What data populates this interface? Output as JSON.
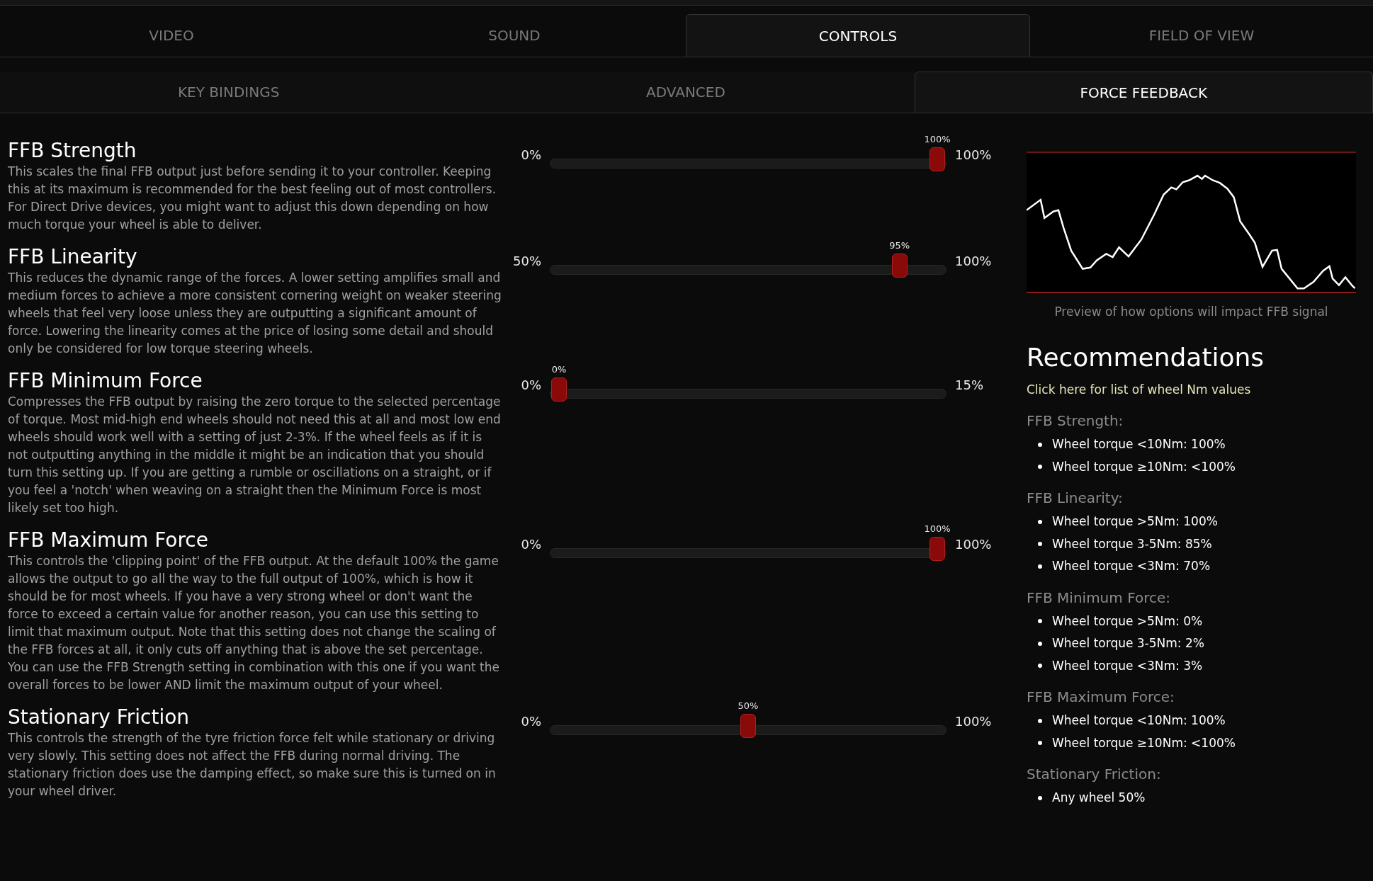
{
  "main_tabs": [
    {
      "label": "VIDEO",
      "selected": false
    },
    {
      "label": "SOUND",
      "selected": false
    },
    {
      "label": "CONTROLS",
      "selected": true
    },
    {
      "label": "FIELD OF VIEW",
      "selected": false
    }
  ],
  "sub_tabs": [
    {
      "label": "KEY BINDINGS",
      "selected": false
    },
    {
      "label": "ADVANCED",
      "selected": false
    },
    {
      "label": "FORCE FEEDBACK",
      "selected": true
    }
  ],
  "settings": [
    {
      "title": "FFB Strength",
      "description": "This scales the final FFB output just before sending it to your controller. Keeping this at its maximum is recommended for the best feeling out of most controllers. For Direct Drive devices, you might want to adjust this down depending on how much torque your wheel is able to deliver.",
      "min": "0%",
      "max": "100%",
      "value": "100%",
      "level": 1
    },
    {
      "title": "FFB Linearity",
      "description": "This reduces the dynamic range of the forces. A lower setting amplifies small and medium forces to achieve a more consistent cornering weight on weaker steering wheels that feel very loose unless they are outputting a significant amount of force. Lowering the linearity comes at the price of losing some detail and should only be considered for low torque steering wheels.",
      "min": "50%",
      "max": "100%",
      "value": "95%",
      "level": 0.9
    },
    {
      "title": "FFB Minimum Force",
      "description": "Compresses the FFB output by raising the zero torque to the selected percentage of torque. Most mid-high end wheels should not need this at all and most low end wheels should work well with a setting of just 2-3%. If the wheel feels as if it is not outputting anything in the middle it might be an indication that you should turn this setting up. If you are getting a rumble or oscillations on a straight, or if you feel a 'notch' when weaving on a straight then the Minimum Force is most likely set too high.",
      "min": "0%",
      "max": "15%",
      "value": "0%",
      "level": 0
    },
    {
      "title": "FFB Maximum Force",
      "description": "This controls the 'clipping point' of the FFB output. At the default 100% the game allows the output to go all the way to the full output of 100%, which is how it should be for most wheels. If you have a very strong wheel or don't want the force to exceed a certain value for another reason, you can use this setting to limit that maximum output. Note that this setting does not change the scaling of the FFB forces at all, it only cuts off anything that is above the set percentage. You can use the FFB Strength setting in combination with this one if you want the overall forces to be lower AND limit the maximum output of your wheel.",
      "min": "0%",
      "max": "100%",
      "value": "100%",
      "level": 1
    },
    {
      "title": "Stationary Friction",
      "description": "This controls the strength of the tyre friction force felt while stationary or driving very slowly. This setting does not affect the FFB during normal driving. The stationary friction does use the damping effect, so make sure this is turned on in your wheel driver.",
      "min": "0%",
      "max": "100%",
      "value": "50%",
      "level": 0.5
    }
  ],
  "preview": {
    "caption": "Preview of how options will impact FFB signal"
  },
  "recommendations": {
    "title": "Recommendations",
    "link": "Click here for list of wheel Nm values",
    "groups": [
      {
        "heading": "FFB Strength:",
        "items": [
          "Wheel torque <10Nm: 100%",
          "Wheel torque ≥10Nm: <100%"
        ]
      },
      {
        "heading": "FFB Linearity:",
        "items": [
          "Wheel torque >5Nm: 100%",
          "Wheel torque 3-5Nm: 85%",
          "Wheel torque <3Nm: 70%"
        ]
      },
      {
        "heading": "FFB Minimum Force:",
        "items": [
          "Wheel torque >5Nm: 0%",
          "Wheel torque 3-5Nm: 2%",
          "Wheel torque <3Nm: 3%"
        ]
      },
      {
        "heading": "FFB Maximum Force:",
        "items": [
          "Wheel torque <10Nm: 100%",
          "Wheel torque ≥10Nm: <100%"
        ]
      },
      {
        "heading": "Stationary Friction:",
        "items": [
          "Any wheel 50%"
        ]
      }
    ]
  }
}
